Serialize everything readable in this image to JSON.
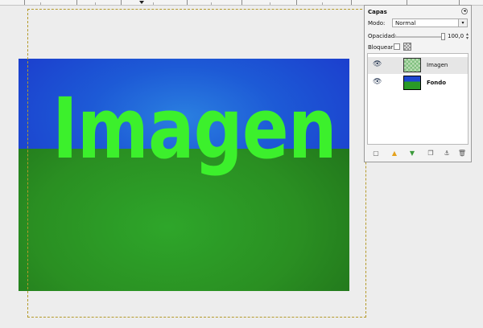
{
  "layers_dock": {
    "title": "Capas",
    "mode_label": "Modo:",
    "mode_value": "Normal",
    "opacity_label": "Opacidad:",
    "opacity_value": "100,0",
    "lock_label": "Bloquear:",
    "layers": [
      {
        "name": "Imagen",
        "visible": true,
        "selected": true
      },
      {
        "name": "Fondo",
        "visible": true,
        "selected": false
      }
    ],
    "toolbar_icons": [
      "new-layer-icon",
      "raise-layer-icon",
      "lower-layer-icon",
      "duplicate-layer-icon",
      "anchor-layer-icon",
      "delete-layer-icon"
    ]
  },
  "canvas": {
    "text": "Imagen",
    "colors": {
      "sky": "#1b3ccd",
      "grass": "#2a8f22",
      "text": "#3cf02c"
    }
  }
}
